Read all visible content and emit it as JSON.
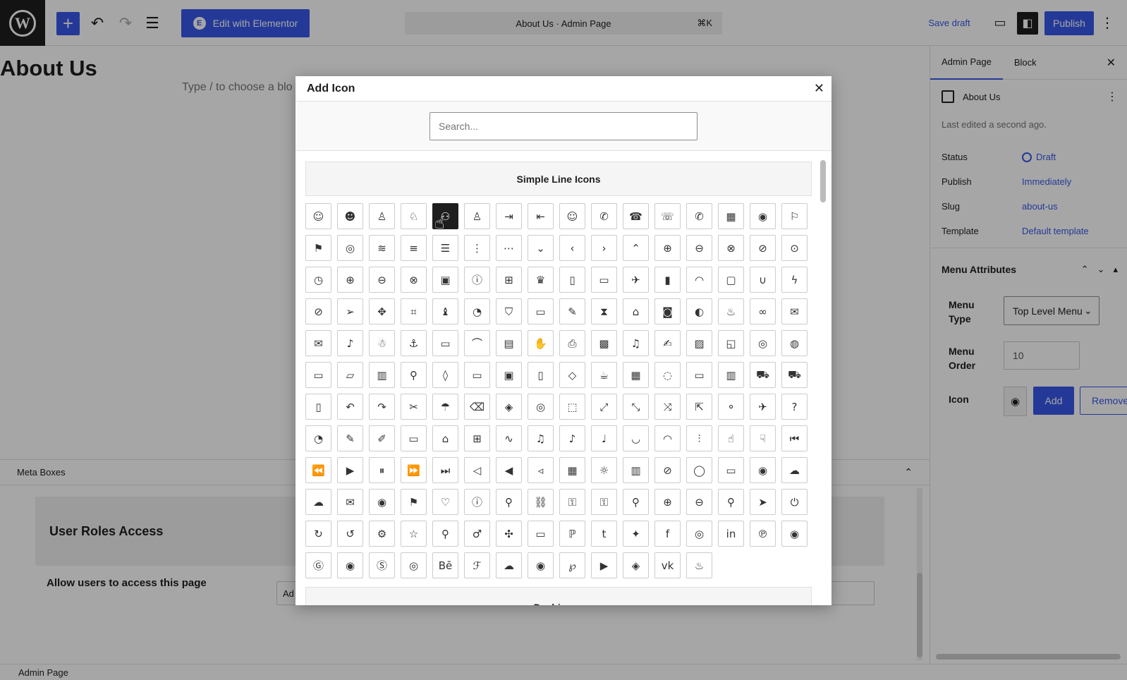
{
  "topbar": {
    "wp_logo": "W",
    "edit_elementor_label": "Edit with Elementor",
    "command_title": "About Us · Admin Page",
    "command_shortcut": "⌘K",
    "save_draft_label": "Save draft",
    "publish_label": "Publish"
  },
  "editor": {
    "page_title": "About Us",
    "block_placeholder": "Type / to choose a blo"
  },
  "meta": {
    "heading": "Meta Boxes",
    "user_roles_title": "User Roles Access",
    "allow_label": "Allow users to access this page",
    "allow_field_value": "Ad"
  },
  "footer": {
    "breadcrumb": "Admin Page"
  },
  "sidebar": {
    "tabs": [
      "Admin Page",
      "Block"
    ],
    "doc_title": "About Us",
    "last_edited": "Last edited a second ago.",
    "props": [
      {
        "key": "Status",
        "value": "Draft"
      },
      {
        "key": "Publish",
        "value": "Immediately"
      },
      {
        "key": "Slug",
        "value": "about-us"
      },
      {
        "key": "Template",
        "value": "Default template"
      }
    ],
    "menu_attributes": {
      "title": "Menu Attributes",
      "menu_type_label": "Menu Type",
      "menu_type_value": "Top Level Menu",
      "menu_order_label": "Menu Order",
      "menu_order_value": "10",
      "icon_label": "Icon",
      "add_label": "Add",
      "remove_label": "Remove"
    }
  },
  "modal": {
    "title": "Add Icon",
    "search_placeholder": "Search...",
    "set1_title": "Simple Line Icons",
    "set2_title": "Dashicons",
    "selected_index": 4,
    "icons": [
      "☺",
      "☻",
      "♙",
      "♘",
      "⚇",
      "♙",
      "⇥",
      "⇤",
      "☺",
      "✆",
      "☎",
      "☏",
      "✆",
      "▦",
      "◉",
      "⚐",
      "⚑",
      "◎",
      "≋",
      "≡",
      "☰",
      "⋮",
      "⋯",
      "⌄",
      "‹",
      "›",
      "⌃",
      "⊕",
      "⊖",
      "⊗",
      "⊘",
      "⊙",
      "◷",
      "⊕",
      "⊖",
      "⊗",
      "▣",
      "ⓘ",
      "⊞",
      "♛",
      "▯",
      "▭",
      "✈",
      "▮",
      "◠",
      "▢",
      "∪",
      "ϟ",
      "⊘",
      "➢",
      "✥",
      "⌗",
      "♝",
      "◔",
      "⛉",
      "▭",
      "✎",
      "⧗",
      "⌂",
      "◙",
      "◐",
      "♨",
      "∞",
      "✉",
      "✉",
      "♪",
      "☃",
      "⚓",
      "▭",
      "⌒",
      "▤",
      "✋",
      "⎙",
      "▩",
      "♫",
      "✍",
      "▨",
      "◱",
      "◎",
      "◍",
      "▭",
      "▱",
      "▥",
      "⚲",
      "◊",
      "▭",
      "▣",
      "▯",
      "◇",
      "☕",
      "▦",
      "◌",
      "▭",
      "▥",
      "⛟",
      "⛟",
      "▯",
      "↶",
      "↷",
      "✂",
      "☂",
      "⌫",
      "◈",
      "◎",
      "⬚",
      "⤢",
      "⤡",
      "⤨",
      "⇱",
      "⚬",
      "✈",
      "?",
      "◔",
      "✎",
      "✐",
      "▭",
      "⌂",
      "⊞",
      "∿",
      "♫",
      "♪",
      "♩",
      "◡",
      "◠",
      "⫶",
      "☝",
      "☟",
      "⏮",
      "⏪",
      "▶",
      "⏸",
      "⏩",
      "⏭",
      "◁",
      "◀",
      "◃",
      "▦",
      "☼",
      "▥",
      "⊘",
      "◯",
      "▭",
      "◉",
      "☁",
      "☁",
      "✉",
      "◉",
      "⚑",
      "♡",
      "ⓘ",
      "⚲",
      "⛓",
      "⚿",
      "⚿",
      "⚲",
      "⊕",
      "⊖",
      "⚲",
      "➤",
      "⏻",
      "↻",
      "↺",
      "⚙",
      "☆",
      "⚲",
      "♂",
      "✣",
      "▭",
      "ℙ",
      "t",
      "✦",
      "f",
      "◎",
      "in",
      "℗",
      "◉",
      "Ⓖ",
      "◉",
      "Ⓢ",
      "◎",
      "Bē",
      "ℱ",
      "☁",
      "◉",
      "℘",
      "▶",
      "◈",
      "vk",
      "♨"
    ]
  }
}
